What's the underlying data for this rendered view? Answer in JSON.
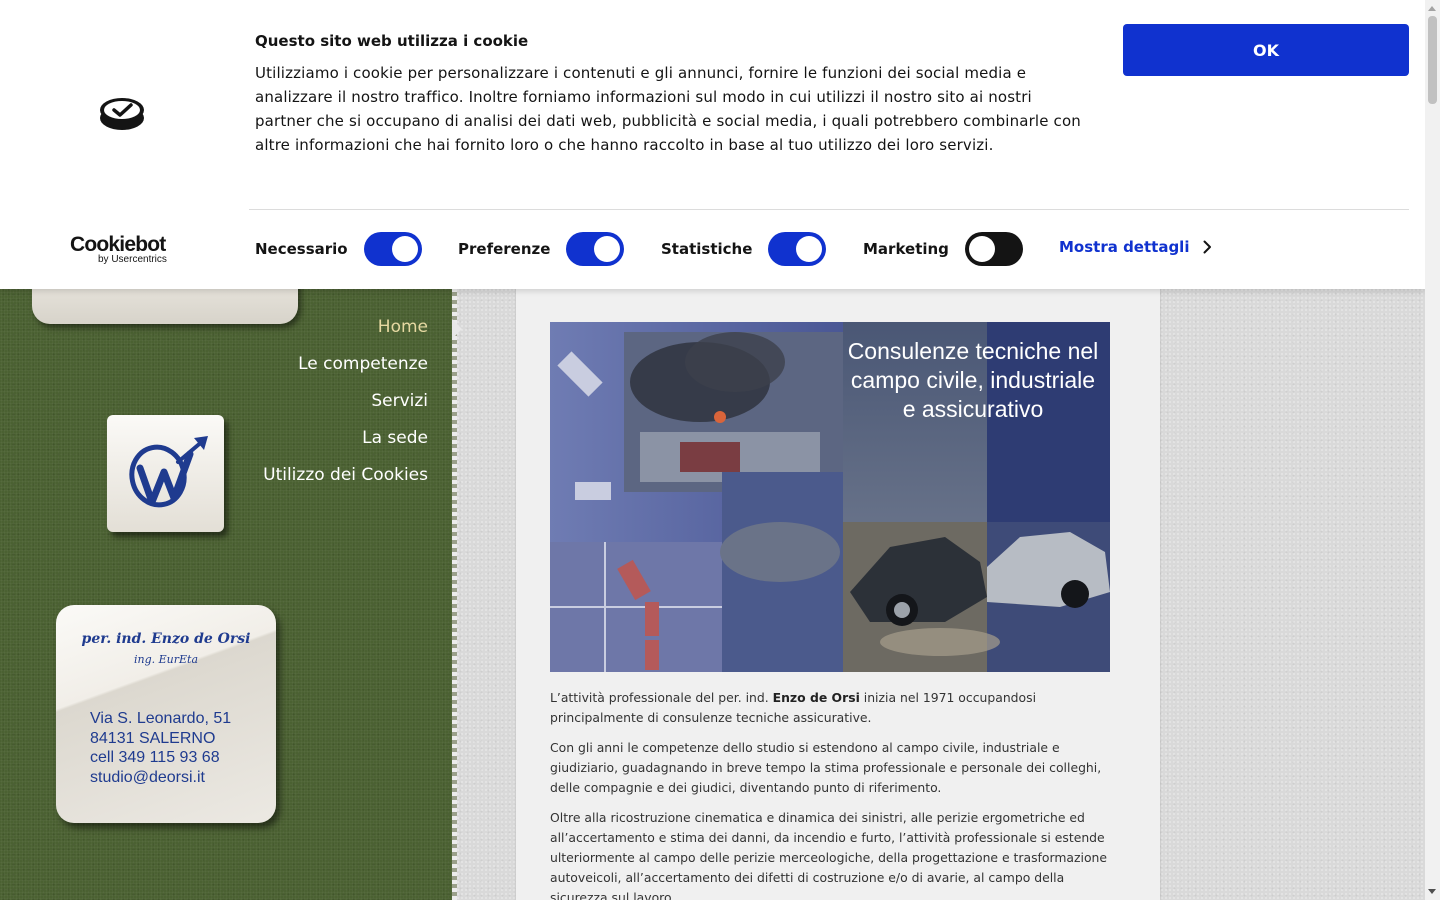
{
  "cookie_banner": {
    "title": "Questo sito web utilizza i cookie",
    "text": "Utilizziamo i cookie per personalizzare i contenuti e gli annunci, fornire le funzioni dei social media e analizzare il nostro traffico. Inoltre forniamo informazioni sul modo in cui utilizzi il nostro sito ai nostri partner che si occupano di analisi dei dati web, pubblicità e social media, i quali potrebbero combinarle con altre informazioni che hai fornito loro o che hanno raccolto in base al tuo utilizzo dei loro servizi.",
    "ok_label": "OK",
    "brand": "Cookiebot",
    "brand_sub": "by Usercentrics",
    "categories": [
      {
        "label": "Necessario",
        "enabled": true
      },
      {
        "label": "Preferenze",
        "enabled": true
      },
      {
        "label": "Statistiche",
        "enabled": true
      },
      {
        "label": "Marketing",
        "enabled": false
      }
    ],
    "details_label": "Mostra dettagli",
    "accent_color": "#1032cf"
  },
  "nav": {
    "items": [
      {
        "label": "Home",
        "active": true
      },
      {
        "label": "Le competenze",
        "active": false
      },
      {
        "label": "Servizi",
        "active": false
      },
      {
        "label": "La sede",
        "active": false
      },
      {
        "label": "Utilizzo dei Cookies",
        "active": false
      }
    ]
  },
  "contact": {
    "name": "per. ind. Enzo de Orsi",
    "title": "ing. EurEta",
    "address": "Via S. Leonardo, 51",
    "city": "84131 SALERNO",
    "phone": "cell  349 115 93 68",
    "email": "studio@deorsi.it"
  },
  "hero": {
    "title": "Consulenze tecniche nel campo civile, industriale e assicurativo"
  },
  "article": {
    "p1_before": "L’attività professionale del per. ind. ",
    "p1_name": "Enzo de Orsi",
    "p1_after": " inizia nel 1971 occupandosi principalmente di consulenze tecniche assicurative.",
    "p2": "Con gli anni le competenze dello studio si estendono al campo civile,  industriale e giudiziario, guadagnando in breve tempo la stima professionale e personale dei colleghi, delle compagnie e dei giudici, diventando punto di riferimento.",
    "p3": "Oltre alla ricostruzione cinematica e dinamica dei sinistri, alle perizie ergometriche ed all’accertamento e stima dei danni, da incendio e furto, l’attività professionale si estende ulteriormente al campo delle perizie merceologiche, della progettazione e trasformazione autoveicoli, all’accertamento dei difetti di costruzione e/o di avarie, al campo della sicurezza sul lavoro."
  }
}
